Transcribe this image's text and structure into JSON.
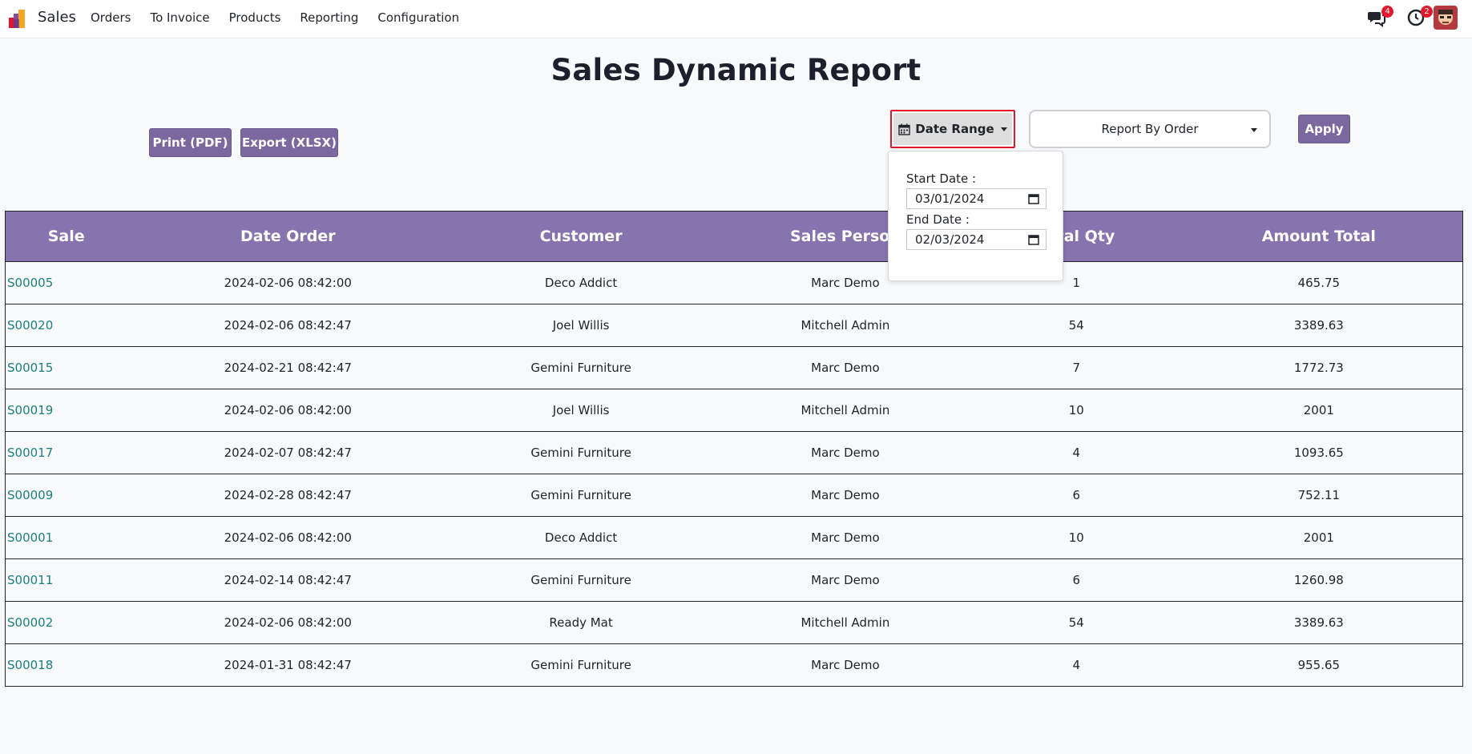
{
  "navbar": {
    "app_name": "Sales",
    "menu": [
      "Orders",
      "To Invoice",
      "Products",
      "Reporting",
      "Configuration"
    ],
    "messages_badge": "4",
    "activities_badge": "2"
  },
  "page": {
    "title": "Sales Dynamic Report"
  },
  "toolbar": {
    "print_label": "Print (PDF)",
    "export_label": "Export (XLSX)",
    "date_range_label": "Date Range",
    "report_by_label": "Report By Order",
    "apply_label": "Apply"
  },
  "date_filter": {
    "start_label": "Start Date :",
    "start_value": "03/01/2024",
    "end_label": "End Date :",
    "end_value": "02/03/2024"
  },
  "table": {
    "headers": [
      "Sale",
      "Date Order",
      "Customer",
      "Sales Person",
      "Total Qty",
      "Amount Total"
    ],
    "rows": [
      {
        "sale": "S00005",
        "date": "2024-02-06 08:42:00",
        "customer": "Deco Addict",
        "person": "Marc Demo",
        "qty": "1",
        "amount": "465.75"
      },
      {
        "sale": "S00020",
        "date": "2024-02-06 08:42:47",
        "customer": "Joel Willis",
        "person": "Mitchell Admin",
        "qty": "54",
        "amount": "3389.63"
      },
      {
        "sale": "S00015",
        "date": "2024-02-21 08:42:47",
        "customer": "Gemini Furniture",
        "person": "Marc Demo",
        "qty": "7",
        "amount": "1772.73"
      },
      {
        "sale": "S00019",
        "date": "2024-02-06 08:42:00",
        "customer": "Joel Willis",
        "person": "Mitchell Admin",
        "qty": "10",
        "amount": "2001"
      },
      {
        "sale": "S00017",
        "date": "2024-02-07 08:42:47",
        "customer": "Gemini Furniture",
        "person": "Marc Demo",
        "qty": "4",
        "amount": "1093.65"
      },
      {
        "sale": "S00009",
        "date": "2024-02-28 08:42:47",
        "customer": "Gemini Furniture",
        "person": "Marc Demo",
        "qty": "6",
        "amount": "752.11"
      },
      {
        "sale": "S00001",
        "date": "2024-02-06 08:42:00",
        "customer": "Deco Addict",
        "person": "Marc Demo",
        "qty": "10",
        "amount": "2001"
      },
      {
        "sale": "S00011",
        "date": "2024-02-14 08:42:47",
        "customer": "Gemini Furniture",
        "person": "Marc Demo",
        "qty": "6",
        "amount": "1260.98"
      },
      {
        "sale": "S00002",
        "date": "2024-02-06 08:42:00",
        "customer": "Ready Mat",
        "person": "Mitchell Admin",
        "qty": "54",
        "amount": "3389.63"
      },
      {
        "sale": "S00018",
        "date": "2024-01-31 08:42:47",
        "customer": "Gemini Furniture",
        "person": "Marc Demo",
        "qty": "4",
        "amount": "955.65"
      }
    ]
  },
  "colors": {
    "brand_purple": "#7b689f",
    "table_header": "#8574ad",
    "link_teal": "#1a7f7f",
    "badge_red": "#e3172c"
  }
}
